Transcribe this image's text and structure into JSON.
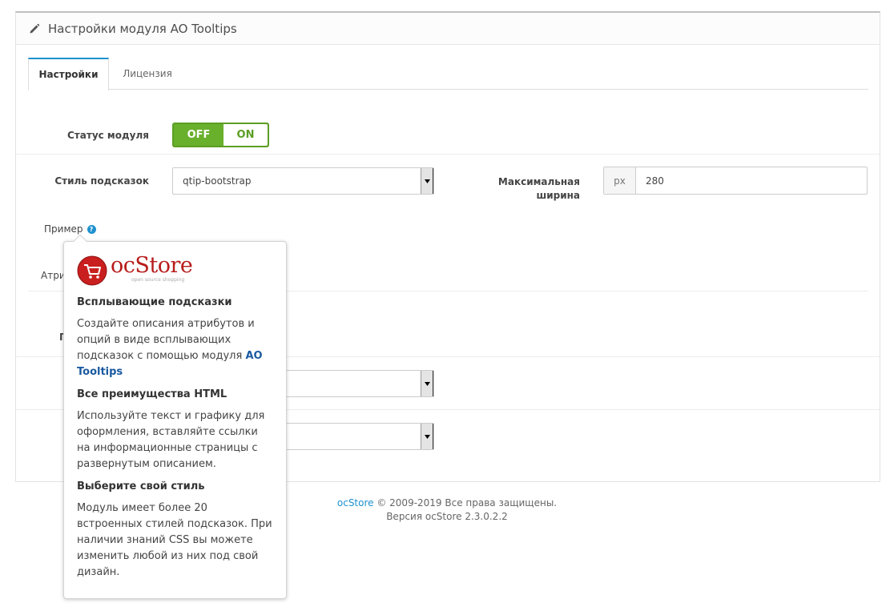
{
  "header": {
    "title": "Настройки модуля AO Tooltips",
    "icon": "pencil-icon"
  },
  "tabs": [
    {
      "label": "Настройки",
      "active": true
    },
    {
      "label": "Лицензия",
      "active": false
    }
  ],
  "form": {
    "status_label": "Статус модуля",
    "toggle_off": "OFF",
    "toggle_on": "ON",
    "toggle_state": "on",
    "style_label": "Стиль подсказок",
    "style_value": "qtip-bootstrap",
    "max_width_label_1": "Максимальная",
    "max_width_label_2": "ширина",
    "max_width_unit": "px",
    "max_width_value": "280",
    "example_label": "Пример",
    "attr_label_partial": "Атри",
    "partial_label_p": "П"
  },
  "tooltip": {
    "logo_word": "ocStore",
    "logo_sub": "open source shopping",
    "h1": "Всплывающие подсказки",
    "p1_text": "Создайте описания атрибутов и опций в виде всплывающих подсказок с помощью модуля ",
    "p1_bold": "AO Tooltips",
    "h2": "Все преимущества HTML",
    "p2": "Используйте текст и графику для оформления, вставляйте ссылки на информационные страницы с развернутым описанием.",
    "h3": "Выберите свой стиль",
    "p3": "Модуль имеет более 20 встроенных стилей подсказок. При наличии знаний CSS вы можете изменить любой из них под свой дизайн."
  },
  "footer": {
    "link": "ocStore",
    "copyright": " © 2009-2019 Все права защищены.",
    "version": "Версия ocStore 2.3.0.2.2"
  },
  "colors": {
    "toggle_green": "#69b02c",
    "link_blue": "#1e91cf",
    "logo_red": "#b81c1c"
  }
}
